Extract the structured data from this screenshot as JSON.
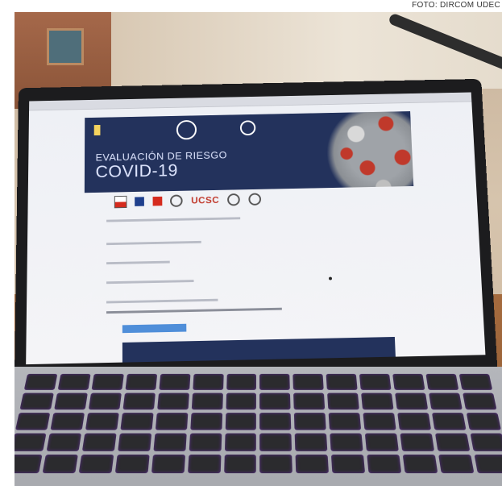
{
  "credit": "FOTO: DIRCOM UDEC",
  "screen": {
    "banner_title": "EVALUACIÓN DE RIESGO",
    "banner_subtitle": "COVID-19",
    "logo_text": "UCSC"
  },
  "colors": {
    "banner_navy": "#23325c",
    "button_blue": "#4f8ed9",
    "virus_red": "#c0392b",
    "keyboard_glow": "#5a2a8c"
  }
}
